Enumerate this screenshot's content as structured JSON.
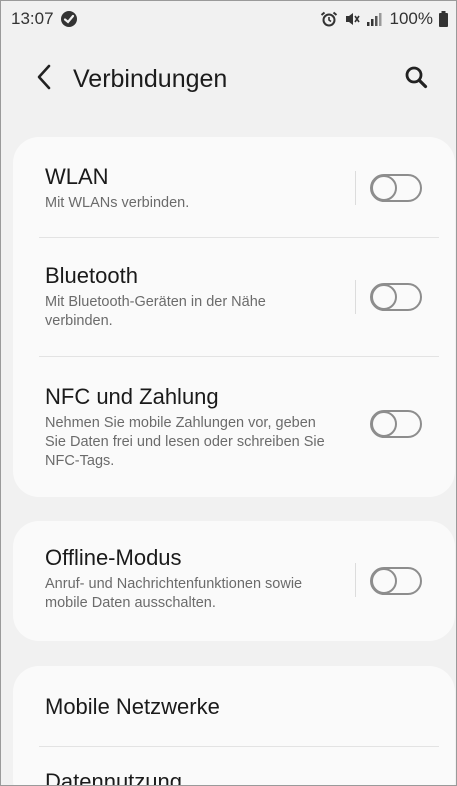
{
  "status_bar": {
    "time": "13:07",
    "battery": "100%",
    "icons": [
      "sync-badge-icon",
      "alarm-icon",
      "mute-icon",
      "signal-icon",
      "battery-icon"
    ]
  },
  "header": {
    "title": "Verbindungen",
    "back_icon": "back-arrow-icon",
    "search_icon": "search-icon"
  },
  "settings": [
    {
      "title": "WLAN",
      "subtitle": "Mit WLANs verbinden.",
      "toggle_on": false
    },
    {
      "title": "Bluetooth",
      "subtitle": "Mit Bluetooth-Geräten in der Nähe verbinden.",
      "toggle_on": false
    },
    {
      "title": "NFC und Zahlung",
      "subtitle": "Nehmen Sie mobile Zahlungen vor, geben Sie Daten frei und lesen oder schreiben Sie NFC-Tags.",
      "toggle_on": false
    },
    {
      "title": "Offline-Modus",
      "subtitle": "Anruf- und Nachrichtenfunktionen sowie mobile Daten ausschalten.",
      "toggle_on": false
    }
  ],
  "more_items": [
    {
      "title": "Mobile Netzwerke"
    },
    {
      "title": "Datennutzung"
    }
  ],
  "colors": {
    "background": "#f1f1f1",
    "card": "#fafafa",
    "toggle_off": "#8d8d8d"
  }
}
